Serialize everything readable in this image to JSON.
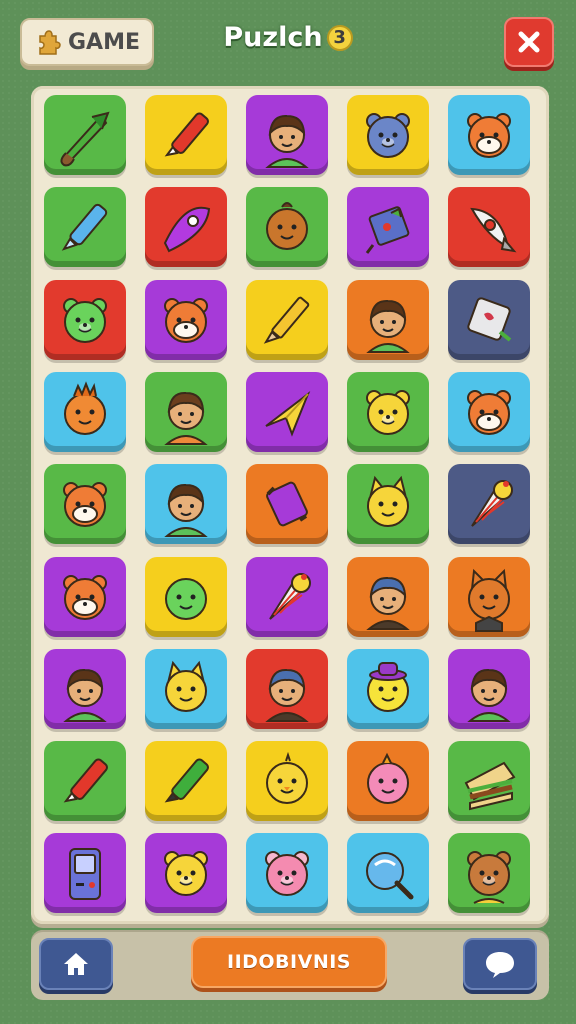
{
  "header": {
    "game_button_label": "GAME",
    "title": "Puzlch",
    "level": "3"
  },
  "footer": {
    "main_button_label": "IIDOBIVNIS"
  },
  "colors": {
    "green": "#58b947",
    "yellow": "#f5cf1d",
    "purple": "#a63ad8",
    "cyan": "#4fc3ea",
    "red": "#e23a2d",
    "orange": "#ec7a23",
    "slate": "#4d5a86"
  },
  "board": {
    "columns": 5,
    "rows": 9,
    "tiles": [
      {
        "bg": "green",
        "icon": "leaf-rocket-icon"
      },
      {
        "bg": "yellow",
        "icon": "red-marker-icon"
      },
      {
        "bg": "purple",
        "icon": "boy-face-icon"
      },
      {
        "bg": "yellow",
        "icon": "blue-bear-icon"
      },
      {
        "bg": "cyan",
        "icon": "hamster-icon"
      },
      {
        "bg": "green",
        "icon": "blue-crayon-icon"
      },
      {
        "bg": "red",
        "icon": "purple-rocket-icon"
      },
      {
        "bg": "green",
        "icon": "orange-chestnut-icon"
      },
      {
        "bg": "purple",
        "icon": "blue-gift-icon"
      },
      {
        "bg": "red",
        "icon": "white-rocket-icon"
      },
      {
        "bg": "red",
        "icon": "green-bear-icon"
      },
      {
        "bg": "purple",
        "icon": "hamster-icon"
      },
      {
        "bg": "yellow",
        "icon": "pencil-icon"
      },
      {
        "bg": "orange",
        "icon": "boy-face-icon"
      },
      {
        "bg": "slate",
        "icon": "tag-icon"
      },
      {
        "bg": "cyan",
        "icon": "orange-critter-icon"
      },
      {
        "bg": "green",
        "icon": "winking-boy-icon"
      },
      {
        "bg": "purple",
        "icon": "paper-plane-icon"
      },
      {
        "bg": "green",
        "icon": "yellow-bear-icon"
      },
      {
        "bg": "cyan",
        "icon": "hamster-icon"
      },
      {
        "bg": "green",
        "icon": "hamster-icon"
      },
      {
        "bg": "cyan",
        "icon": "boy-face-icon"
      },
      {
        "bg": "orange",
        "icon": "purple-candy-icon"
      },
      {
        "bg": "green",
        "icon": "yellow-cat-icon"
      },
      {
        "bg": "slate",
        "icon": "ice-cream-cone-icon"
      },
      {
        "bg": "purple",
        "icon": "hamster-icon"
      },
      {
        "bg": "yellow",
        "icon": "green-ball-icon"
      },
      {
        "bg": "purple",
        "icon": "ice-cream-cone-icon"
      },
      {
        "bg": "orange",
        "icon": "boy-with-cap-icon"
      },
      {
        "bg": "orange",
        "icon": "fox-icon"
      },
      {
        "bg": "purple",
        "icon": "boy-face-icon"
      },
      {
        "bg": "cyan",
        "icon": "yellow-cat-icon"
      },
      {
        "bg": "red",
        "icon": "boy-with-cap-icon"
      },
      {
        "bg": "cyan",
        "icon": "chick-with-hat-icon"
      },
      {
        "bg": "purple",
        "icon": "boy-face-icon"
      },
      {
        "bg": "green",
        "icon": "red-marker-icon"
      },
      {
        "bg": "yellow",
        "icon": "green-marker-icon"
      },
      {
        "bg": "yellow",
        "icon": "chick-icon"
      },
      {
        "bg": "orange",
        "icon": "pink-critter-icon"
      },
      {
        "bg": "green",
        "icon": "sandwich-icon"
      },
      {
        "bg": "purple",
        "icon": "game-console-icon"
      },
      {
        "bg": "purple",
        "icon": "yellow-bear-icon"
      },
      {
        "bg": "cyan",
        "icon": "pink-bear-icon"
      },
      {
        "bg": "cyan",
        "icon": "lollipop-icon"
      },
      {
        "bg": "green",
        "icon": "bear-boy-icon"
      }
    ]
  }
}
